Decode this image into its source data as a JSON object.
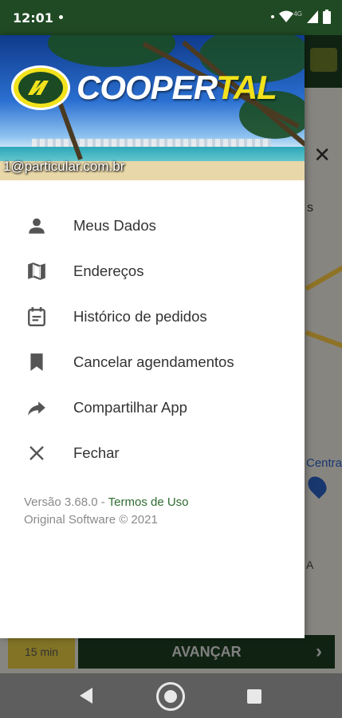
{
  "status_bar": {
    "time": "12:01",
    "network": "4G"
  },
  "background": {
    "partial_text": "s",
    "map_label": "Centra",
    "map_letter": "A",
    "eta": "15 min",
    "advance_button": "AVANÇAR"
  },
  "drawer": {
    "logo": {
      "text_white": "COOPER",
      "text_yellow": "TAL",
      "brand_green": "#1c4b23",
      "brand_yellow": "#f2e21c"
    },
    "email": "1@particular.com.br",
    "menu": [
      {
        "label": "Meus Dados",
        "icon": "person-icon"
      },
      {
        "label": "Endereços",
        "icon": "map-icon"
      },
      {
        "label": "Histórico de pedidos",
        "icon": "calendar-list-icon"
      },
      {
        "label": "Cancelar agendamentos",
        "icon": "bookmark-icon"
      },
      {
        "label": "Compartilhar App",
        "icon": "share-arrow-icon"
      },
      {
        "label": "Fechar",
        "icon": "close-icon"
      }
    ],
    "footer": {
      "version": "Versão 3.68.0 - ",
      "terms_link": "Termos de Uso",
      "copyright": "Original Software © 2021"
    }
  }
}
